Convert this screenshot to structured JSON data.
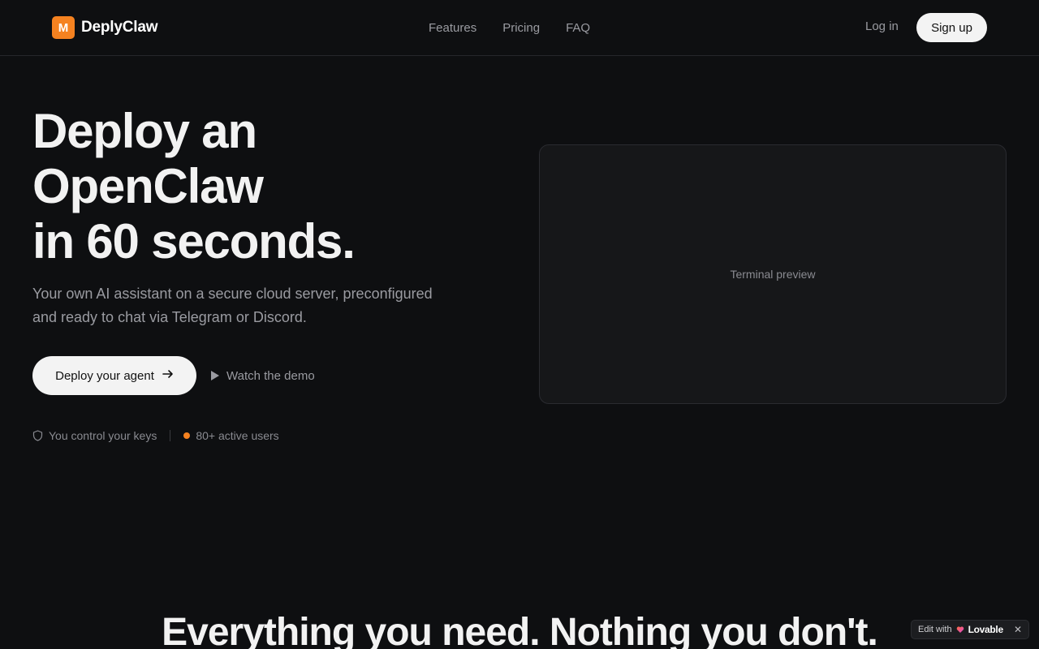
{
  "header": {
    "logo_letter": "M",
    "brand": "DeplyClaw",
    "nav": [
      "Features",
      "Pricing",
      "FAQ"
    ],
    "login": "Log in",
    "signup": "Sign up"
  },
  "hero": {
    "title_lines": [
      "Deploy an",
      "OpenClaw",
      "in 60 seconds."
    ],
    "subtitle": "Your own AI assistant on a secure cloud server, preconfigured and ready to chat via Telegram or Discord.",
    "cta_primary": "Deploy your agent",
    "cta_secondary": "Watch the demo",
    "trust": [
      "You control your keys",
      "80+ active users"
    ]
  },
  "preview": {
    "label": "Terminal preview"
  },
  "features": {
    "title": "Everything you need. Nothing you don't."
  },
  "badge": {
    "prefix": "Edit with",
    "brand": "Lovable"
  },
  "colors": {
    "accent": "#f58220",
    "background": "#0e0f11",
    "button": "#f3f3f3"
  }
}
